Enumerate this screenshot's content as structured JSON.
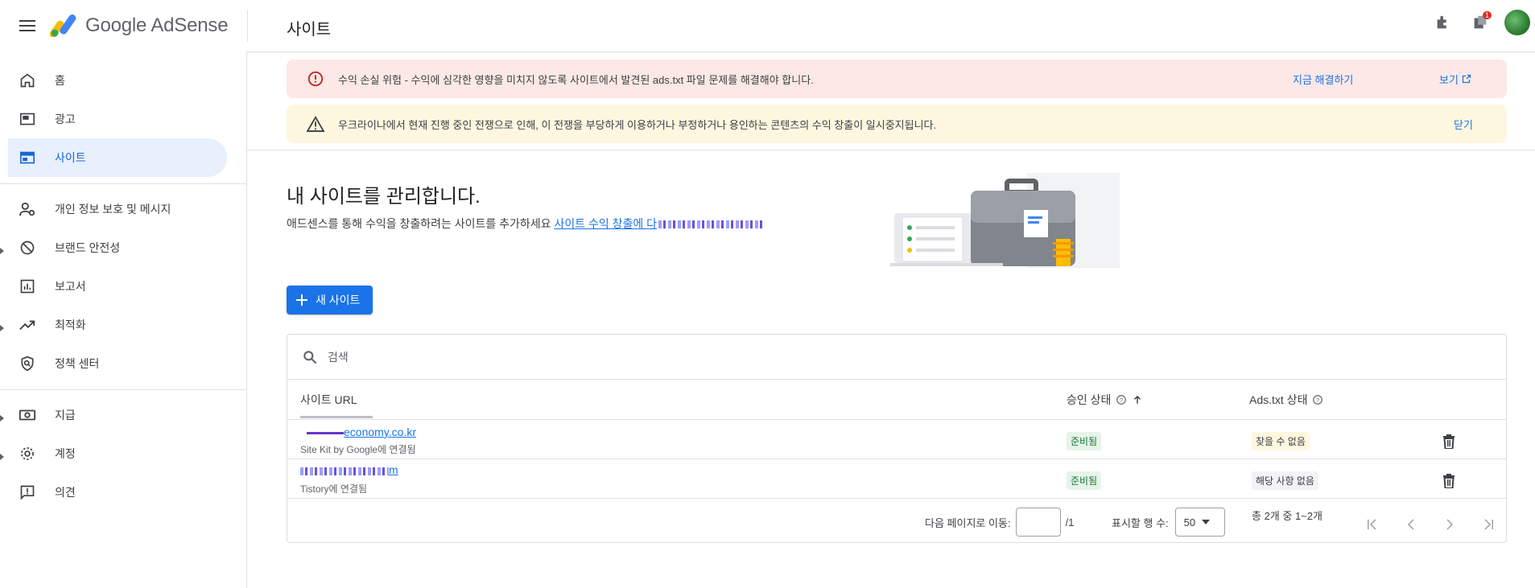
{
  "app": {
    "logo_text": "Google AdSense",
    "page_title": "사이트",
    "notification_count": "1"
  },
  "sidebar": {
    "items": [
      {
        "label": "홈",
        "icon": "home-icon"
      },
      {
        "label": "광고",
        "icon": "ads-icon"
      },
      {
        "label": "사이트",
        "icon": "sites-icon",
        "active": true
      },
      {
        "label": "개인 정보 보호 및 메시지",
        "icon": "privacy-icon"
      },
      {
        "label": "브랜드 안전성",
        "icon": "block-icon"
      },
      {
        "label": "보고서",
        "icon": "reports-icon"
      },
      {
        "label": "최적화",
        "icon": "trending-icon"
      },
      {
        "label": "정책 센터",
        "icon": "policy-icon"
      },
      {
        "label": "지급",
        "icon": "payments-icon"
      },
      {
        "label": "계정",
        "icon": "gear-icon"
      },
      {
        "label": "의견",
        "icon": "feedback-icon"
      }
    ]
  },
  "banners": {
    "error": {
      "text": "수익 손실 위험 - 수익에 심각한 영향을 미치지 않도록 사이트에서 발견된 ads.txt 파일 문제를 해결해야 합니다.",
      "action_fix": "지금 해결하기",
      "action_view": "보기"
    },
    "warning": {
      "text": "우크라이나에서 현재 진행 중인 전쟁으로 인해, 이 전쟁을 부당하게 이용하거나 부정하거나 용인하는 콘텐츠의 수익 창출이 일시중지됩니다.",
      "action_close": "닫기"
    }
  },
  "main": {
    "title": "내 사이트를 관리합니다.",
    "subtitle": "애드센스를 통해 수익을 창출하려는 사이트를 추가하세요",
    "subtitle_link": "사이트 수익 창출에 다",
    "new_site_button": "새 사이트"
  },
  "table": {
    "search_placeholder": "검색",
    "headers": {
      "url": "사이트 URL",
      "approval": "승인 상태",
      "ads_txt": "Ads.txt 상태"
    },
    "rows": [
      {
        "url": "economy.co.kr",
        "sub": "Site Kit by Google에 연결됨",
        "approval": "준비됨",
        "ads_txt": "찾을 수 없음"
      },
      {
        "url": "m",
        "sub": "Tistory에 연결됨",
        "approval": "준비됨",
        "ads_txt": "해당 사항 없음"
      }
    ]
  },
  "pagination": {
    "goto_label": "다음 페이지로 이동:",
    "page_total": "/1",
    "rows_label": "표시할 행 수:",
    "rows_value": "50",
    "summary": "총 2개 중 1~2개"
  },
  "colors": {
    "accent": "#1a73e8",
    "error_bg": "#fce8e6",
    "warn_bg": "#fef7e0",
    "active_nav_bg": "#e8f0fe"
  }
}
